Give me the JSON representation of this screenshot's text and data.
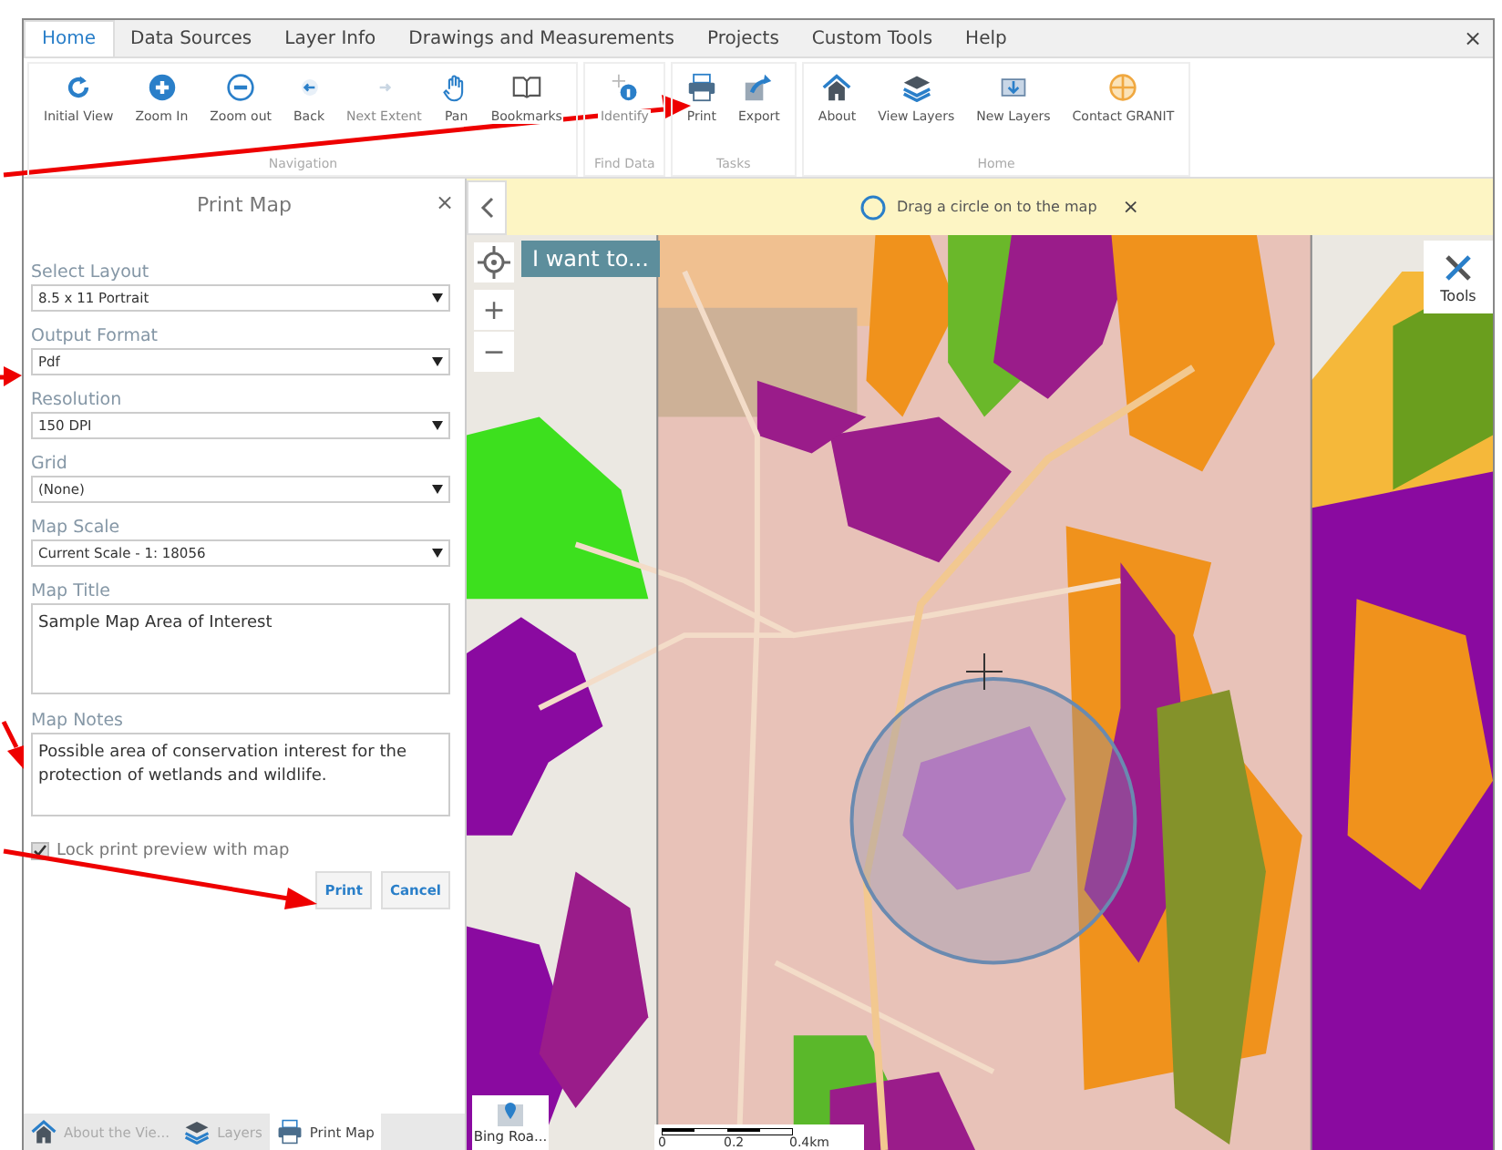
{
  "ribbon_tabs": [
    {
      "label": "Home",
      "selected": true
    },
    {
      "label": "Data Sources",
      "selected": false
    },
    {
      "label": "Layer Info",
      "selected": false
    },
    {
      "label": "Drawings and Measurements",
      "selected": false
    },
    {
      "label": "Projects",
      "selected": false
    },
    {
      "label": "Custom Tools",
      "selected": false
    },
    {
      "label": "Help",
      "selected": false
    }
  ],
  "window_close": "×",
  "ribbon_groups": [
    {
      "label": "Navigation",
      "buttons": [
        {
          "label": "Initial View",
          "disabled": false
        },
        {
          "label": "Zoom In",
          "disabled": false
        },
        {
          "label": "Zoom out",
          "disabled": false
        },
        {
          "label": "Back",
          "disabled": false
        },
        {
          "label": "Next Extent",
          "disabled": true
        },
        {
          "label": "Pan",
          "disabled": false
        },
        {
          "label": "Bookmarks",
          "disabled": false
        }
      ]
    },
    {
      "label": "Find Data",
      "buttons": [
        {
          "label": "Identify",
          "disabled": true
        }
      ]
    },
    {
      "label": "Tasks",
      "buttons": [
        {
          "label": "Print",
          "disabled": false
        },
        {
          "label": "Export",
          "disabled": false
        }
      ]
    },
    {
      "label": "Home",
      "buttons": [
        {
          "label": "About",
          "disabled": false
        },
        {
          "label": "View Layers",
          "disabled": false
        },
        {
          "label": "New Layers",
          "disabled": false
        },
        {
          "label": "Contact GRANIT",
          "disabled": false
        }
      ]
    }
  ],
  "print_panel": {
    "title": "Print Map",
    "close": "×",
    "fields": [
      {
        "kind": "select",
        "label": "Select Layout",
        "value": "8.5 x 11 Portrait"
      },
      {
        "kind": "select",
        "label": "Output Format",
        "value": "Pdf"
      },
      {
        "kind": "select",
        "label": "Resolution",
        "value": "150 DPI"
      },
      {
        "kind": "select",
        "label": "Grid",
        "value": "(None)"
      },
      {
        "kind": "select",
        "label": "Map Scale",
        "value": "Current Scale - 1: 18056"
      },
      {
        "kind": "textarea",
        "label": "Map Title",
        "value": "Sample Map Area of Interest"
      },
      {
        "kind": "textarea",
        "label": "Map Notes",
        "value": "Possible area of conservation interest for the protection of wetlands and wildlife."
      }
    ],
    "lock": {
      "label": "Lock print preview with map",
      "checked": true
    },
    "buttons": [
      "Print",
      "Cancel"
    ]
  },
  "bottom_tabs": [
    {
      "label": "About the Vie...",
      "selected": false
    },
    {
      "label": "Layers",
      "selected": false
    },
    {
      "label": "Print Map",
      "selected": true
    }
  ],
  "banner": {
    "text": "Drag a circle on to the map",
    "close": "×"
  },
  "map": {
    "i_want_to": "I want to...",
    "tools": "Tools",
    "zoom_in": "+",
    "zoom_out": "−",
    "basemap": "Bing Roa...",
    "scale_labels": [
      "0",
      "0.2",
      "0.4km"
    ]
  }
}
